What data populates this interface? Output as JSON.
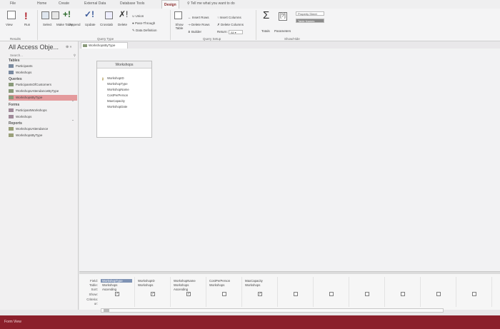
{
  "ribbon_tabs": [
    "File",
    "Home",
    "Create",
    "External Data",
    "Database Tools",
    "Design"
  ],
  "active_tab": "Design",
  "tell_me": "Tell me what you want to do",
  "results": {
    "view": "View",
    "run": "Run",
    "group": "Results"
  },
  "query_type": {
    "select": "Select",
    "make_table": "Make Table",
    "append": "Append",
    "update": "Update",
    "crosstab": "Crosstab",
    "delete": "Delete",
    "union": "Union",
    "pass_through": "Pass-Through",
    "data_definition": "Data Definition",
    "group": "Query Type"
  },
  "query_setup": {
    "show_table": "Show Table",
    "insert_rows": "Insert Rows",
    "delete_rows": "Delete Rows",
    "builder": "Builder",
    "insert_columns": "Insert Columns",
    "delete_columns": "Delete Columns",
    "return_label": "Return:",
    "return_value": "All",
    "group": "Query Setup"
  },
  "show_hide": {
    "totals": "Totals",
    "parameters": "Parameters",
    "property_sheet": "Property Sheet",
    "table_names": "Table Names",
    "group": "Show/Hide"
  },
  "nav": {
    "title": "All Access Obje...",
    "search_placeholder": "Search...",
    "categories": [
      {
        "label": "Tables",
        "items": [
          "Participants",
          "Workshops"
        ]
      },
      {
        "label": "Queries",
        "items": [
          "ParticipantsOfCustomers",
          "WorkshopsAttendanceByType",
          "WorkshopsByType"
        ]
      },
      {
        "label": "Forms",
        "items": [
          "ParticipantWorkshops",
          "Workshops"
        ]
      },
      {
        "label": "Reports",
        "items": [
          "WorkshopsAttendance",
          "WorkshopsByType"
        ]
      }
    ],
    "selected_item": "WorkshopsByType"
  },
  "document_tab": "WorkshopsByType",
  "table_box": {
    "title": "Workshops",
    "fields": [
      "WorkshopID",
      "WorkshopType",
      "WorkshopName",
      "CostPerPerson",
      "MaxCapacity",
      "WorkshopDate"
    ]
  },
  "grid": {
    "row_labels": [
      "Field:",
      "Table:",
      "Sort:",
      "Show:",
      "Criteria:",
      "or:"
    ],
    "columns": [
      {
        "field": "WorkshopType",
        "table": "Workshops",
        "sort": "Ascending",
        "show": true
      },
      {
        "field": "WorkshopID",
        "table": "Workshops",
        "sort": "",
        "show": true
      },
      {
        "field": "WorkshopName",
        "table": "Workshops",
        "sort": "Ascending",
        "show": true
      },
      {
        "field": "CostPerPerson",
        "table": "Workshops",
        "sort": "",
        "show": false
      },
      {
        "field": "MaxCapacity",
        "table": "Workshops",
        "sort": "",
        "show": true
      },
      {
        "field": "",
        "table": "",
        "sort": "",
        "show": false
      },
      {
        "field": "",
        "table": "",
        "sort": "",
        "show": false
      },
      {
        "field": "",
        "table": "",
        "sort": "",
        "show": false
      },
      {
        "field": "",
        "table": "",
        "sort": "",
        "show": false
      },
      {
        "field": "",
        "table": "",
        "sort": "",
        "show": false
      },
      {
        "field": "",
        "table": "",
        "sort": "",
        "show": false
      }
    ]
  },
  "status": "Form View",
  "colors": {
    "accent": "#8b1f2b",
    "selected": "#e49a9c",
    "grid_selected": "#7f93b4"
  }
}
